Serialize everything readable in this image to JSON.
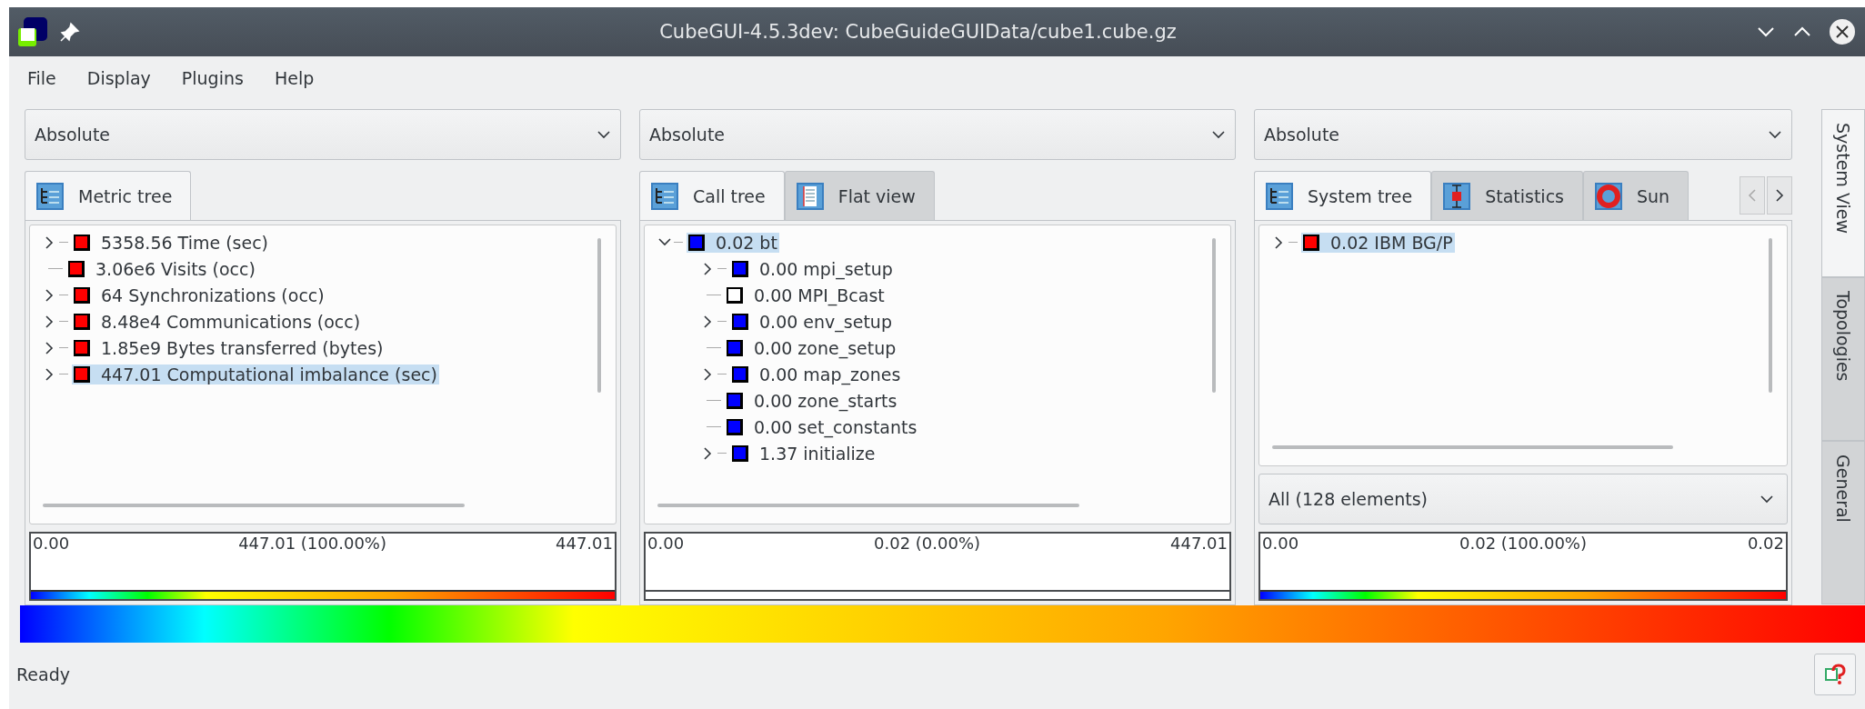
{
  "window": {
    "title": "CubeGUI-4.5.3dev: CubeGuideGUIData/cube1.cube.gz"
  },
  "menu": [
    "File",
    "Display",
    "Plugins",
    "Help"
  ],
  "panels": [
    {
      "combo": "Absolute",
      "tabs": [
        {
          "label": "Metric tree",
          "kind": "tree",
          "selected": true
        }
      ],
      "tab_scroll": false,
      "tree": [
        {
          "text": "5358.56 Time (sec)",
          "color": "#ff0000",
          "kind": "collapsed",
          "selected": false
        },
        {
          "text": "3.06e6 Visits (occ)",
          "color": "#ff0000",
          "kind": "leaf",
          "selected": false
        },
        {
          "text": "64 Synchronizations (occ)",
          "color": "#ff0000",
          "kind": "collapsed",
          "selected": false
        },
        {
          "text": "8.48e4 Communications (occ)",
          "color": "#ff0000",
          "kind": "collapsed",
          "selected": false
        },
        {
          "text": "1.85e9 Bytes transferred (bytes)",
          "color": "#ff0000",
          "kind": "collapsed",
          "selected": false
        },
        {
          "text": "447.01 Computational imbalance (sec)",
          "color": "#ff0000",
          "kind": "collapsed",
          "selected": true
        }
      ],
      "scale": {
        "min": "0.00",
        "current": "447.01 (100.00%)",
        "max": "447.01",
        "gradient": true
      }
    },
    {
      "combo": "Absolute",
      "tabs": [
        {
          "label": "Call tree",
          "kind": "tree",
          "selected": true
        },
        {
          "label": "Flat view",
          "kind": "list",
          "selected": false
        }
      ],
      "tab_scroll": false,
      "tree": [
        {
          "text": "0.02 bt",
          "color": "#0000ff",
          "kind": "expanded",
          "selected": true,
          "children": [
            {
              "text": "0.00 mpi_setup",
              "color": "#0000ff",
              "kind": "collapsed",
              "selected": false
            },
            {
              "text": "0.00 MPI_Bcast",
              "color": "#ffffff",
              "kind": "leaf",
              "selected": false
            },
            {
              "text": "0.00 env_setup",
              "color": "#0000ff",
              "kind": "collapsed",
              "selected": false
            },
            {
              "text": "0.00 zone_setup",
              "color": "#0000ff",
              "kind": "leaf",
              "selected": false
            },
            {
              "text": "0.00 map_zones",
              "color": "#0000ff",
              "kind": "collapsed",
              "selected": false
            },
            {
              "text": "0.00 zone_starts",
              "color": "#0000ff",
              "kind": "leaf",
              "selected": false
            },
            {
              "text": "0.00 set_constants",
              "color": "#0000ff",
              "kind": "leaf",
              "selected": false
            },
            {
              "text": "1.37 initialize",
              "color": "#0000ff",
              "kind": "collapsed",
              "selected": false
            }
          ]
        }
      ],
      "scale": {
        "min": "0.00",
        "current": "0.02 (0.00%)",
        "max": "447.01",
        "gradient": false
      }
    },
    {
      "combo": "Absolute",
      "tabs": [
        {
          "label": "System tree",
          "kind": "tree",
          "selected": true
        },
        {
          "label": "Statistics",
          "kind": "stats",
          "selected": false
        },
        {
          "label": "Sun",
          "kind": "sunburst",
          "selected": false
        }
      ],
      "tab_scroll": true,
      "tree": [
        {
          "text": "0.02 IBM BG/P",
          "color": "#ff0000",
          "kind": "collapsed",
          "selected": true
        }
      ],
      "filter": "All (128 elements)",
      "scale": {
        "min": "0.00",
        "current": "0.02 (100.00%)",
        "max": "0.02",
        "gradient": true
      }
    }
  ],
  "side_tabs": [
    {
      "label": "System View",
      "selected": true
    },
    {
      "label": "Topologies",
      "selected": false
    },
    {
      "label": "General",
      "selected": false
    }
  ],
  "status_bar": "Ready"
}
